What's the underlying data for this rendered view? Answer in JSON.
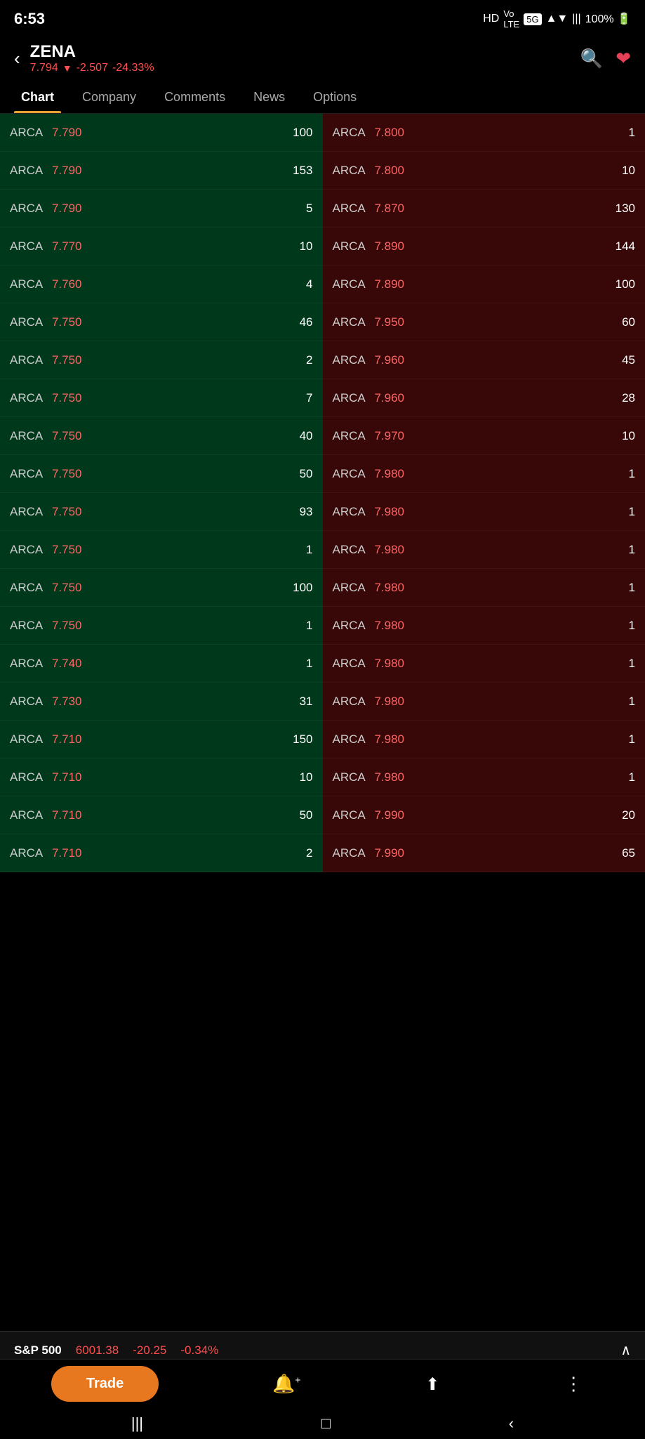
{
  "statusBar": {
    "time": "6:53",
    "icons": "Vo LTE 5G ▲▼ |||  100% 🔋"
  },
  "header": {
    "backLabel": "‹",
    "ticker": "ZENA",
    "price": "7.794",
    "arrow": "▼",
    "change": "-2.507",
    "changePct": "-24.33%"
  },
  "tabs": [
    {
      "id": "chart",
      "label": "Chart",
      "active": true
    },
    {
      "id": "company",
      "label": "Company",
      "active": false
    },
    {
      "id": "comments",
      "label": "Comments",
      "active": false
    },
    {
      "id": "news",
      "label": "News",
      "active": false
    },
    {
      "id": "options",
      "label": "Options",
      "active": false
    }
  ],
  "bids": [
    {
      "exchange": "ARCA",
      "price": "7.790",
      "qty": "100"
    },
    {
      "exchange": "ARCA",
      "price": "7.790",
      "qty": "153"
    },
    {
      "exchange": "ARCA",
      "price": "7.790",
      "qty": "5"
    },
    {
      "exchange": "ARCA",
      "price": "7.770",
      "qty": "10"
    },
    {
      "exchange": "ARCA",
      "price": "7.760",
      "qty": "4"
    },
    {
      "exchange": "ARCA",
      "price": "7.750",
      "qty": "46"
    },
    {
      "exchange": "ARCA",
      "price": "7.750",
      "qty": "2"
    },
    {
      "exchange": "ARCA",
      "price": "7.750",
      "qty": "7"
    },
    {
      "exchange": "ARCA",
      "price": "7.750",
      "qty": "40"
    },
    {
      "exchange": "ARCA",
      "price": "7.750",
      "qty": "50"
    },
    {
      "exchange": "ARCA",
      "price": "7.750",
      "qty": "93"
    },
    {
      "exchange": "ARCA",
      "price": "7.750",
      "qty": "1"
    },
    {
      "exchange": "ARCA",
      "price": "7.750",
      "qty": "100"
    },
    {
      "exchange": "ARCA",
      "price": "7.750",
      "qty": "1"
    },
    {
      "exchange": "ARCA",
      "price": "7.740",
      "qty": "1"
    },
    {
      "exchange": "ARCA",
      "price": "7.730",
      "qty": "31"
    },
    {
      "exchange": "ARCA",
      "price": "7.710",
      "qty": "150"
    },
    {
      "exchange": "ARCA",
      "price": "7.710",
      "qty": "10"
    },
    {
      "exchange": "ARCA",
      "price": "7.710",
      "qty": "50"
    },
    {
      "exchange": "ARCA",
      "price": "7.710",
      "qty": "2"
    }
  ],
  "asks": [
    {
      "exchange": "ARCA",
      "price": "7.800",
      "qty": "1"
    },
    {
      "exchange": "ARCA",
      "price": "7.800",
      "qty": "10"
    },
    {
      "exchange": "ARCA",
      "price": "7.870",
      "qty": "130"
    },
    {
      "exchange": "ARCA",
      "price": "7.890",
      "qty": "144"
    },
    {
      "exchange": "ARCA",
      "price": "7.890",
      "qty": "100"
    },
    {
      "exchange": "ARCA",
      "price": "7.950",
      "qty": "60"
    },
    {
      "exchange": "ARCA",
      "price": "7.960",
      "qty": "45"
    },
    {
      "exchange": "ARCA",
      "price": "7.960",
      "qty": "28"
    },
    {
      "exchange": "ARCA",
      "price": "7.970",
      "qty": "10"
    },
    {
      "exchange": "ARCA",
      "price": "7.980",
      "qty": "1"
    },
    {
      "exchange": "ARCA",
      "price": "7.980",
      "qty": "1"
    },
    {
      "exchange": "ARCA",
      "price": "7.980",
      "qty": "1"
    },
    {
      "exchange": "ARCA",
      "price": "7.980",
      "qty": "1"
    },
    {
      "exchange": "ARCA",
      "price": "7.980",
      "qty": "1"
    },
    {
      "exchange": "ARCA",
      "price": "7.980",
      "qty": "1"
    },
    {
      "exchange": "ARCA",
      "price": "7.980",
      "qty": "1"
    },
    {
      "exchange": "ARCA",
      "price": "7.980",
      "qty": "1"
    },
    {
      "exchange": "ARCA",
      "price": "7.980",
      "qty": "1"
    },
    {
      "exchange": "ARCA",
      "price": "7.990",
      "qty": "20"
    },
    {
      "exchange": "ARCA",
      "price": "7.990",
      "qty": "65"
    }
  ],
  "bottomTicker": {
    "name": "S&P 500",
    "price": "6001.38",
    "change": "-20.25",
    "pct": "-0.34%",
    "chevron": "∧"
  },
  "bottomNav": {
    "tradeLabel": "Trade",
    "bellIcon": "🔔",
    "shareIcon": "⬆",
    "menuIcon": "⋮"
  },
  "androidNav": {
    "recent": "|||",
    "home": "□",
    "back": "‹"
  }
}
